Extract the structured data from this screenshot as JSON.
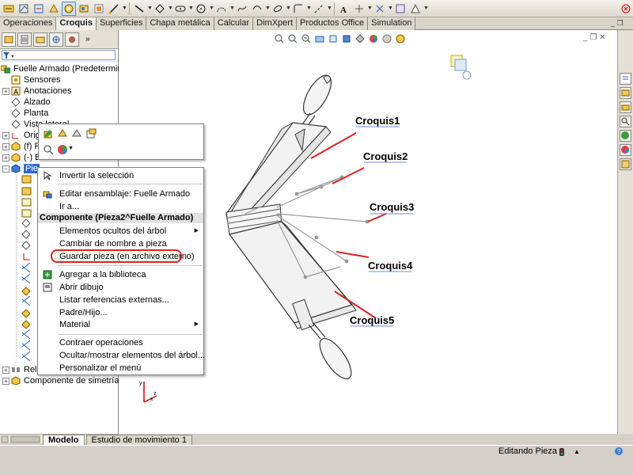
{
  "toolbar": {
    "icons": [
      "smart-dimension-icon",
      "sketch-icon",
      "exit-sketch-icon",
      "3d-sketch-icon",
      "line-icon",
      "rectangle-icon",
      "slot-icon",
      "circle-icon",
      "arc-icon",
      "spline-icon",
      "ellipse-icon",
      "fillet-icon",
      "point-icon",
      "centerline-icon",
      "text-icon",
      "trim-icon",
      "convert-icon",
      "mirror-icon",
      "display-relations-icon",
      "close-icon"
    ]
  },
  "tabs": [
    "Operaciones",
    "Croquis",
    "Superficies",
    "Chapa metálica",
    "Calcular",
    "DimXpert",
    "Productos Office",
    "Simulation"
  ],
  "active_tab": "Croquis",
  "tree": {
    "root": "Fuelle Armado  (Predeterminado",
    "items": [
      "Sensores",
      "Anotaciones",
      "Alzado",
      "Planta",
      "Vista lateral",
      "Orig",
      "(f) F",
      "(-) E"
    ],
    "selected_prefix": "Pie",
    "bottom_items": [
      "Rela",
      "Componente de simetría1"
    ]
  },
  "mini_toolbar": {
    "icons": [
      "edit-part-icon",
      "open-part-icon",
      "hide-components-icon",
      "component-properties-icon",
      "zoom-to-selection-icon",
      "appearance-icon"
    ]
  },
  "context_menu": {
    "items": [
      {
        "label": "Invertir la selección",
        "icon": "invert-selection-icon"
      },
      {
        "label": "Editar ensamblaje: Fuelle Armado",
        "icon": "edit-assembly-icon"
      },
      {
        "label": "Ir a..."
      },
      {
        "label": "Elementos ocultos del árbol",
        "submenu": true
      },
      {
        "label": "Cambiar de nombre a pieza"
      },
      {
        "label": "Guardar pieza (en archivo externo)"
      },
      {
        "label": "Agregar a la biblioteca",
        "icon": "add-library-icon"
      },
      {
        "label": "Abrir dibujo",
        "icon": "open-drawing-icon"
      },
      {
        "label": "Listar referencias externas..."
      },
      {
        "label": "Padre/Hijo..."
      },
      {
        "label": "Material",
        "submenu": true
      },
      {
        "label": "Contraer operaciones"
      },
      {
        "label": "Ocultar/mostrar elementos del árbol..."
      },
      {
        "label": "Personalizar el menú"
      }
    ],
    "header": "Componente (Pieza2^Fuelle Armado)"
  },
  "callouts": [
    "Croquis1",
    "Croquis2",
    "Croquis3",
    "Croquis4",
    "Croquis5"
  ],
  "bottom_tabs": [
    "Modelo",
    "Estudio de movimiento 1"
  ],
  "status": "Editando Pieza",
  "colors": {
    "highlight_oval": "#e02020",
    "callout_line": "#e02020",
    "selected": "#316ac5"
  }
}
